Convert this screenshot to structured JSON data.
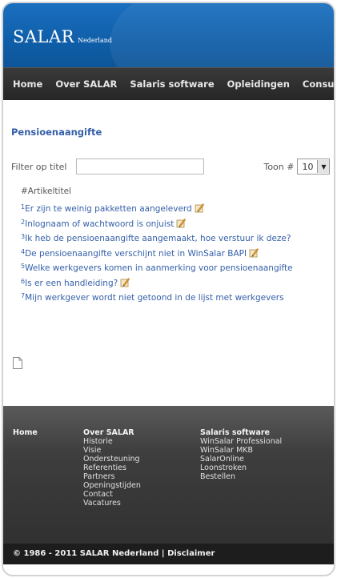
{
  "header": {
    "logo_main": "SALAR",
    "logo_sub": "Nederland"
  },
  "nav": {
    "items": [
      "Home",
      "Over SALAR",
      "Salaris software",
      "Opleidingen",
      "Consulta"
    ]
  },
  "main": {
    "title": "Pensioenaangifte",
    "filter_label": "Filter op titel",
    "filter_value": "",
    "toon_label": "Toon #",
    "toon_value": "10",
    "column_header": "#Artikeltitel",
    "items": [
      {
        "num": "1",
        "title": "Er zijn te weinig pakketten aangeleverd",
        "editable": true
      },
      {
        "num": "2",
        "title": "Inlognaam of wachtwoord is onjuist",
        "editable": true
      },
      {
        "num": "3",
        "title": "Ik heb de pensioenaangifte aangemaakt, hoe verstuur ik deze?",
        "editable": false
      },
      {
        "num": "4",
        "title": "De pensioenaangifte verschijnt niet in WinSalar BAPI",
        "editable": true
      },
      {
        "num": "5",
        "title": "Welke werkgevers komen in aanmerking voor pensioenaangifte",
        "editable": false
      },
      {
        "num": "6",
        "title": "Is er een handleiding?",
        "editable": true
      },
      {
        "num": "7",
        "title": "Mijn werkgever wordt niet getoond in de lijst met werkgevers",
        "editable": false
      }
    ]
  },
  "footer": {
    "col1": {
      "heading": "Home",
      "links": []
    },
    "col2": {
      "heading": "Over SALAR",
      "links": [
        "Historie",
        "Visie",
        "Ondersteuning",
        "Referenties",
        "Partners",
        "Openingstijden",
        "Contact",
        "Vacatures"
      ]
    },
    "col3": {
      "heading": "Salaris software",
      "links": [
        "WinSalar Professional",
        "WinSalar MKB",
        "SalarOnline",
        "Loonstroken",
        "Bestellen"
      ]
    },
    "copyright": "© 1986 - 2011 SALAR Nederland | Disclaimer"
  },
  "colors": {
    "header_blue": "#1565b3",
    "nav_dark": "#2f2f2f",
    "link_blue": "#3560a8",
    "footer_dark": "#333333"
  }
}
